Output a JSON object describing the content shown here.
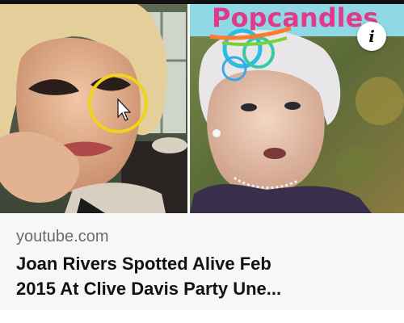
{
  "thumbnail": {
    "left_image": "woman-closeup-with-circle-highlight",
    "right_image": "woman-with-white-hair",
    "overlay_text": "Popcandles",
    "info_icon": "info-icon",
    "info_glyph": "i",
    "highlight_color": "#f2d21b"
  },
  "caption": {
    "domain": "youtube.com",
    "title": "Joan Rivers Spotted Alive Feb\n2015 At Clive Davis Party Une..."
  }
}
